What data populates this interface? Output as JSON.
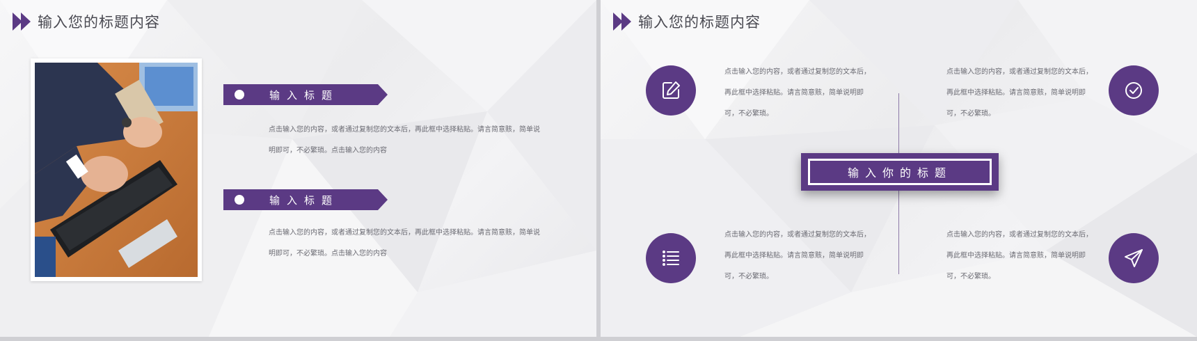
{
  "colors": {
    "accent": "#5b3a84",
    "text": "#6b6b73",
    "title": "#4a4a52"
  },
  "left_slide": {
    "title": "输入您的标题内容",
    "title_icon": "double-chevron-right-icon",
    "photo": "hands-typing-keyboard-photo",
    "sections": [
      {
        "heading": "输入标题",
        "body_line1": "点击输入您的内容，或者通过复制您的文本后，再此框中选择粘贴。请言简意赅，简单说",
        "body_line2": "明即可，不必繁琐。点击输入您的内容"
      },
      {
        "heading": "输入标题",
        "body_line1": "点击输入您的内容，或者通过复制您的文本后，再此框中选择粘贴。请言简意赅，简单说",
        "body_line2": "明即可，不必繁琐。点击输入您的内容"
      }
    ]
  },
  "right_slide": {
    "title": "输入您的标题内容",
    "title_icon": "double-chevron-right-icon",
    "center_title": "输入你的标题",
    "items": [
      {
        "icon": "edit-icon",
        "line1": "点击输入您的内容，或者通过复制您的文本后，",
        "line2": "再此框中选择粘贴。请言简意赅，简单说明即",
        "line3": "可，不必繁琐。"
      },
      {
        "icon": "check-circle-icon",
        "line1": "点击输入您的内容，或者通过复制您的文本后，",
        "line2": "再此框中选择粘贴。请言简意赅，简单说明即",
        "line3": "可，不必繁琐。"
      },
      {
        "icon": "list-icon",
        "line1": "点击输入您的内容，或者通过复制您的文本后，",
        "line2": "再此框中选择粘贴。请言简意赅，简单说明即",
        "line3": "可，不必繁琐。"
      },
      {
        "icon": "paper-plane-icon",
        "line1": "点击输入您的内容，或者通过复制您的文本后，",
        "line2": "再此框中选择粘贴。请言简意赅，简单说明即",
        "line3": "可，不必繁琐。"
      }
    ]
  }
}
